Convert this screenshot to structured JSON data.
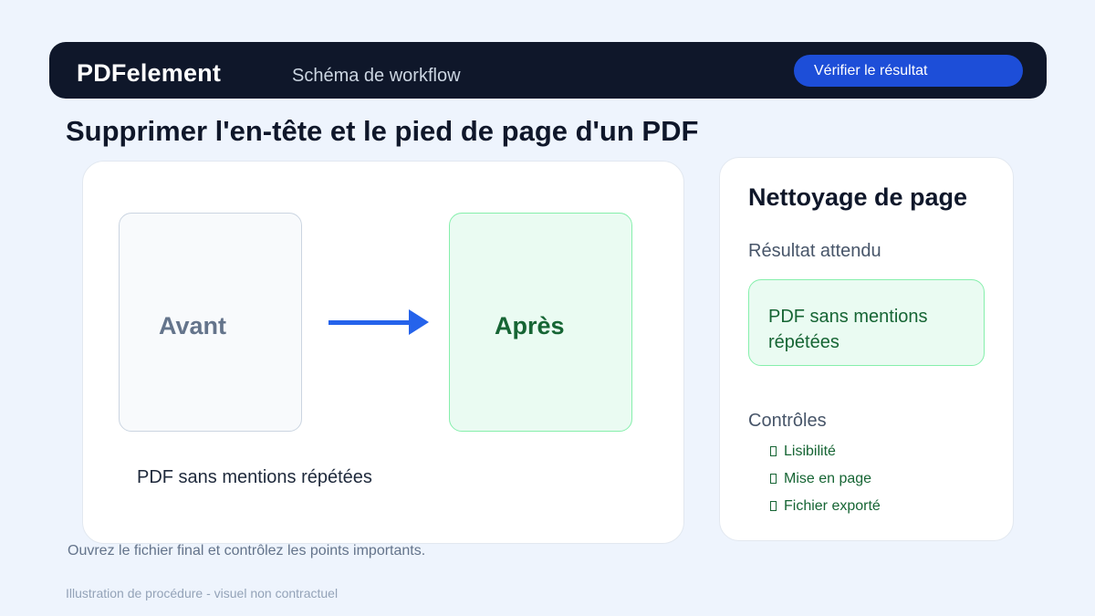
{
  "header": {
    "app_name": "PDFelement",
    "section": "Schéma de workflow",
    "verify_button": "Vérifier le résultat"
  },
  "page_title": "Supprimer l'en-tête et le pied de page d'un PDF",
  "comparison": {
    "before_label": "Avant",
    "after_label": "Après",
    "caption": "PDF sans mentions répétées"
  },
  "side_panel": {
    "title": "Nettoyage de page",
    "expected_label": "Résultat attendu",
    "expected_value": "PDF sans mentions répétées",
    "checks_label": "Contrôles",
    "checks": [
      "Lisibilité",
      "Mise en page",
      "Fichier exporté"
    ]
  },
  "footer": {
    "instruction": "Ouvrez le fichier final et contrôlez les points importants.",
    "disclaimer": "Illustration de procédure - visuel non contractuel"
  },
  "colors": {
    "header_bg": "#0f172a",
    "accent": "#1d4ed8",
    "arrow": "#2563eb",
    "success": "#166534",
    "success_bg": "#eafbf2"
  },
  "icons": {
    "arrow": "arrow-right-icon",
    "check": "checkbox-icon"
  }
}
